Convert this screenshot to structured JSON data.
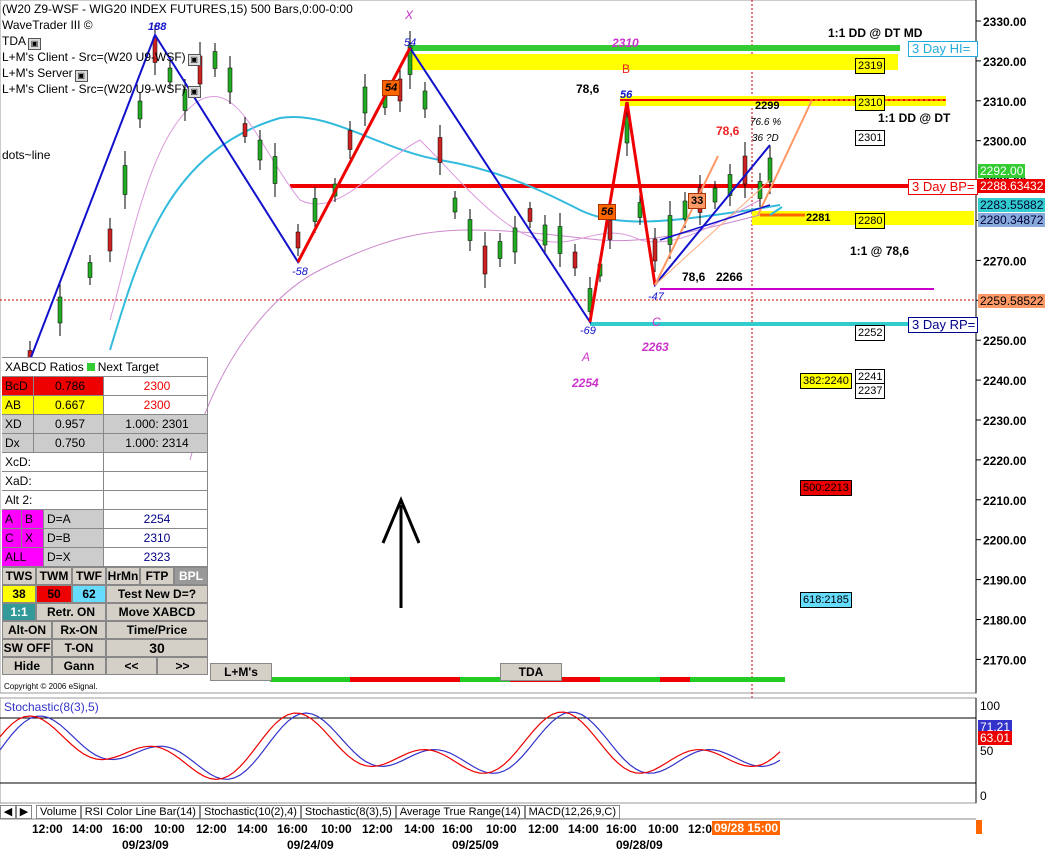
{
  "header": {
    "title": "(W20 Z9-WSF - WIG20 INDEX FUTURES,15) 500 Bars,0:00-0:00",
    "line1": "WaveTrader III ©",
    "line2": "TDA",
    "line3": "L+M's Client - Src=(W20 U9-WSF)",
    "line4": "L+M's Server",
    "line5": "L+M's Client - Src=(W20 U9-WSF)",
    "dots": "dots~line"
  },
  "price_axis": [
    "2330.00",
    "2320.00",
    "2310.00",
    "2300.00",
    "2290.00",
    "2280.00",
    "2270.00",
    "2260.00",
    "2250.00",
    "2240.00",
    "2230.00",
    "2220.00",
    "2210.00",
    "2200.00",
    "2190.00",
    "2180.00",
    "2170.00"
  ],
  "price_tags": {
    "last": "2292.00",
    "bp": "2288.63432",
    "t1": "2283.55882",
    "t2": "2280.34872",
    "cross": "2259.58522"
  },
  "lines": {
    "day_hi": "3 Day HI=",
    "day_bp": "3 Day BP=",
    "day_rp": "3 Day RP="
  },
  "labels": {
    "x_label": "X",
    "x_pts": "54",
    "b_label": "B",
    "b_val": "2310",
    "a_label": "A",
    "a_val": "2254",
    "c_label": "C",
    "c_val": "2263",
    "p188": "188",
    "p58": "-58",
    "p56": "56",
    "p69": "-69",
    "p47": "-47",
    "r786a": "78,6",
    "r786b": "78,6",
    "r786c": "78,6",
    "v2266": "2266",
    "r766": "76.6 %",
    "d36": "36 ?D",
    "dd_md": "1:1 DD @ DT MD",
    "dd_dt": "1:1 DD @ DT",
    "one_786": "1:1 @ 78,6",
    "v2281": "2281",
    "v2299": "2299",
    "box2319": "2319",
    "box2310": "2310",
    "box2301": "2301",
    "box2280": "2280",
    "box2252": "2252",
    "box2241": "2241",
    "box2237": "2237",
    "fib382": "382:2240",
    "fib500": "500:2213",
    "fib618": "618:2185",
    "badge54": "54",
    "badge56": "56",
    "badge33": "33"
  },
  "xabcd_panel": {
    "title": "XABCD Ratios",
    "next_target": "Next Target",
    "rows": [
      {
        "label": "BcD",
        "ratio": "0.786",
        "target": "2300"
      },
      {
        "label": "AB",
        "ratio": "0.667",
        "target": "2300"
      },
      {
        "label": "XD",
        "ratio": "0.957",
        "target": "1.000: 2301"
      },
      {
        "label": "Dx",
        "ratio": "0.750",
        "target": "1.000: 2314"
      }
    ],
    "xcd": "XcD:",
    "xad": "XaD:",
    "alt2": "Alt 2:",
    "d_rows": [
      {
        "k1": "A",
        "k2": "B",
        "label": "D=A",
        "value": "2254"
      },
      {
        "k1": "C",
        "k2": "X",
        "label": "D=B",
        "value": "2310"
      },
      {
        "k1": "ALL",
        "k2": "",
        "label": "D=X",
        "value": "2323"
      }
    ],
    "tabs": [
      "TWS",
      "TWM",
      "TWF",
      "HrMn",
      "FTP",
      "BPL"
    ],
    "nums": [
      "38",
      "50",
      "62"
    ],
    "test_new": "Test New D=?",
    "one_one": "1:1",
    "retr": "Retr. ON",
    "move": "Move XABCD",
    "alt_on": "Alt-ON",
    "rx_on": "Rx-ON",
    "time_price": "Time/Price",
    "sw_off": "SW OFF",
    "t_on": "T-ON",
    "thirty": "30",
    "hide": "Hide",
    "gann": "Gann",
    "prev": "<<",
    "next": ">>",
    "lm": "L+M's"
  },
  "tda_tab": "TDA",
  "copyright": "Copyright © 2006 eSignal.",
  "stochastic": {
    "title": "Stochastic(8(3),5)",
    "axis": [
      "100",
      "50",
      "0"
    ],
    "v1": "71.21",
    "v2": "63.01"
  },
  "bottom_tabs": [
    "Volume",
    "RSI Color Line Bar(14)",
    "Stochastic(10(2),4)",
    "Stochastic(8(3),5)",
    "Average True Range(14)",
    "MACD(12,26,9,C)"
  ],
  "time_axis": [
    "12:00",
    "14:00",
    "16:00",
    "10:00",
    "12:00",
    "14:00",
    "16:00",
    "10:00",
    "12:00",
    "14:00",
    "16:00",
    "10:00",
    "12:00",
    "14:00",
    "16:00",
    "10:00",
    "12:00"
  ],
  "dates": [
    "09/23/09",
    "09/24/09",
    "09/25/09",
    "09/28/09"
  ],
  "cursor_time": "09/28 15:00"
}
